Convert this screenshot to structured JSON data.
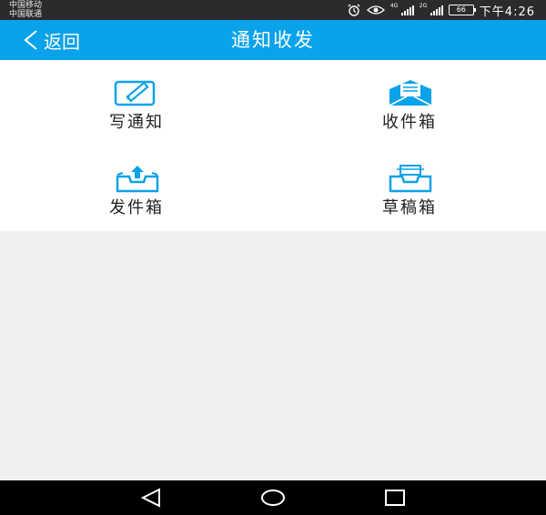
{
  "status_bar": {
    "carrier_1": "中国移动",
    "carrier_2": "中国联通",
    "signal_1_tag": "4G",
    "signal_2_tag": "2G",
    "battery": "66",
    "time": "下午4:26",
    "icons": [
      "alarm-icon",
      "eye-icon",
      "signal-icon",
      "battery-icon"
    ]
  },
  "header": {
    "back_label": "返回",
    "title": "通知收发",
    "background_color": "#0aa2ea"
  },
  "menu": {
    "items": [
      {
        "label": "写通知",
        "icon": "edit-icon"
      },
      {
        "label": "收件箱",
        "icon": "inbox-mail-icon"
      },
      {
        "label": "发件箱",
        "icon": "outbox-icon"
      },
      {
        "label": "草稿箱",
        "icon": "drafts-icon"
      }
    ],
    "icon_color": "#0aa2ea"
  },
  "nav_bar": {
    "buttons": [
      "back-triangle-icon",
      "home-circle-icon",
      "recents-square-icon"
    ]
  }
}
